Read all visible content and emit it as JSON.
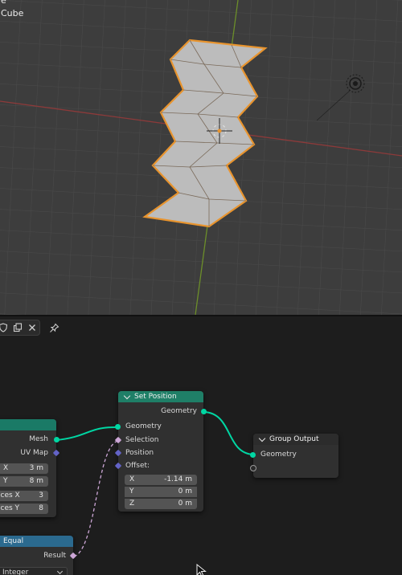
{
  "viewport": {
    "header_line1": "e",
    "header_line2": "Cube"
  },
  "toolbar": {
    "buttons": [
      "shield-icon",
      "duplicate-icon",
      "close-icon"
    ],
    "pin": "pin-icon"
  },
  "nodes": {
    "grid": {
      "outputs": {
        "mesh": "Mesh",
        "uv_map": "UV Map"
      },
      "fields": [
        {
          "label": "X",
          "value": "3 m"
        },
        {
          "label": "Y",
          "value": "8 m"
        },
        {
          "label": "ices X",
          "value": "3"
        },
        {
          "label": "ices Y",
          "value": "8"
        }
      ],
      "header_color": "#1a7a66"
    },
    "set_position": {
      "title": "Set Position",
      "header_color": "#1f7f67",
      "output": "Geometry",
      "inputs": {
        "geometry": "Geometry",
        "selection": "Selection",
        "position": "Position",
        "offset": "Offset:"
      },
      "offset": [
        {
          "label": "X",
          "value": "-1.14 m"
        },
        {
          "label": "Y",
          "value": "0 m"
        },
        {
          "label": "Z",
          "value": "0 m"
        }
      ]
    },
    "group_output": {
      "title": "Group Output",
      "input": "Geometry",
      "header_color": "#2c2c2c"
    },
    "compare": {
      "title": "Equal",
      "header_color": "#2b6a8f",
      "output": "Result",
      "dropdown": "Integer"
    }
  },
  "colors": {
    "geometry_socket": "#00d6a3",
    "vector_socket": "#6363c7",
    "boolean_socket": "#cca6d6",
    "selection_outline": "#e8942e"
  }
}
